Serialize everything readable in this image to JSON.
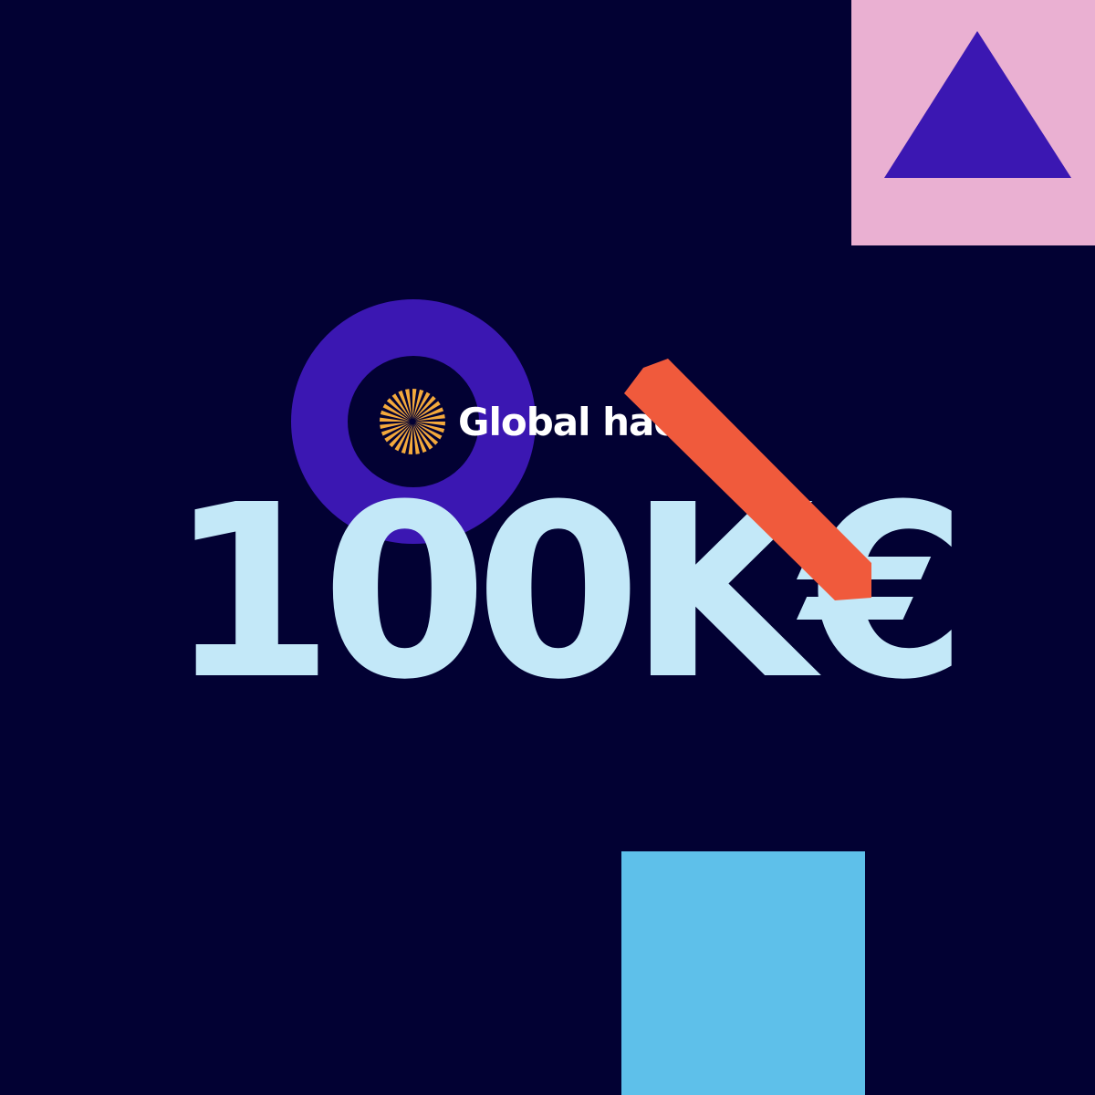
{
  "brand": {
    "name": "Global hack",
    "logo_icon": "sunburst-icon"
  },
  "headline": {
    "amount": "100K€"
  },
  "decor": {
    "shapes": [
      "triangle-icon",
      "ring-icon",
      "diagonal-bar-icon",
      "square-icon"
    ]
  },
  "colors": {
    "background": "#020133",
    "pink_tile": "#eab0d2",
    "triangle": "#3b17b2",
    "ring": "#3b17b2",
    "bar": "#f05a3c",
    "square": "#5ec0ea",
    "amount_text": "#c3e8f8",
    "logo_mark": "#f4a93c",
    "logo_text": "#ffffff"
  }
}
